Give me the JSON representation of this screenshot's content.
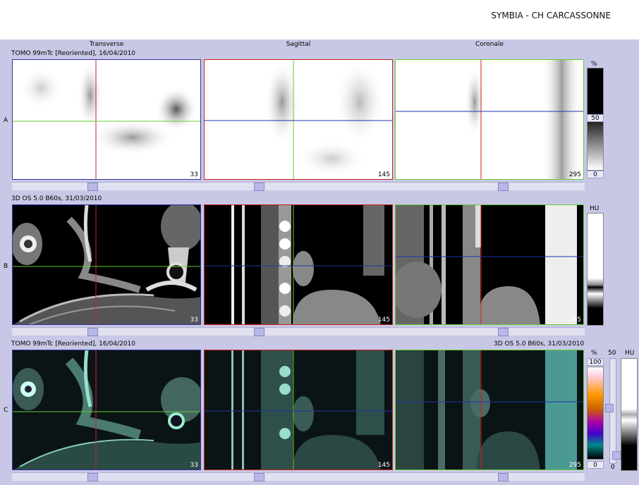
{
  "app": {
    "title": "SYMBIA - CH CARCASSONNE"
  },
  "columns": [
    "Transverse",
    "Sagittal",
    "Coronale"
  ],
  "rows": [
    {
      "letter": "A",
      "title": "TOMO 99mTc [Reoriented], 16/04/2010",
      "slices": [
        "33",
        "145",
        "295"
      ]
    },
    {
      "letter": "B",
      "title": "3D  OS  5.0  B60s, 31/03/2010",
      "slices": [
        "33",
        "145",
        "295"
      ]
    },
    {
      "letter": "C",
      "title": "TOMO 99mTc [Reoriented], 16/04/2010",
      "title_right": "3D  OS  5.0  B60s, 31/03/2010",
      "slices": [
        "33",
        "145",
        "295"
      ]
    }
  ],
  "scales": {
    "a": {
      "unit": "%",
      "mid": "50",
      "min": "0"
    },
    "b": {
      "unit": "HU"
    },
    "c": {
      "unit": "%",
      "top": "100",
      "min": "0",
      "blend": "50",
      "blend_min": "0",
      "hu_unit": "HU"
    }
  },
  "colors": {
    "background": "#c8c8e6",
    "crosshair_red": "#cc2222",
    "crosshair_green": "#66cc33",
    "crosshair_blue": "#2233aa",
    "border_blue": "#3333aa"
  }
}
